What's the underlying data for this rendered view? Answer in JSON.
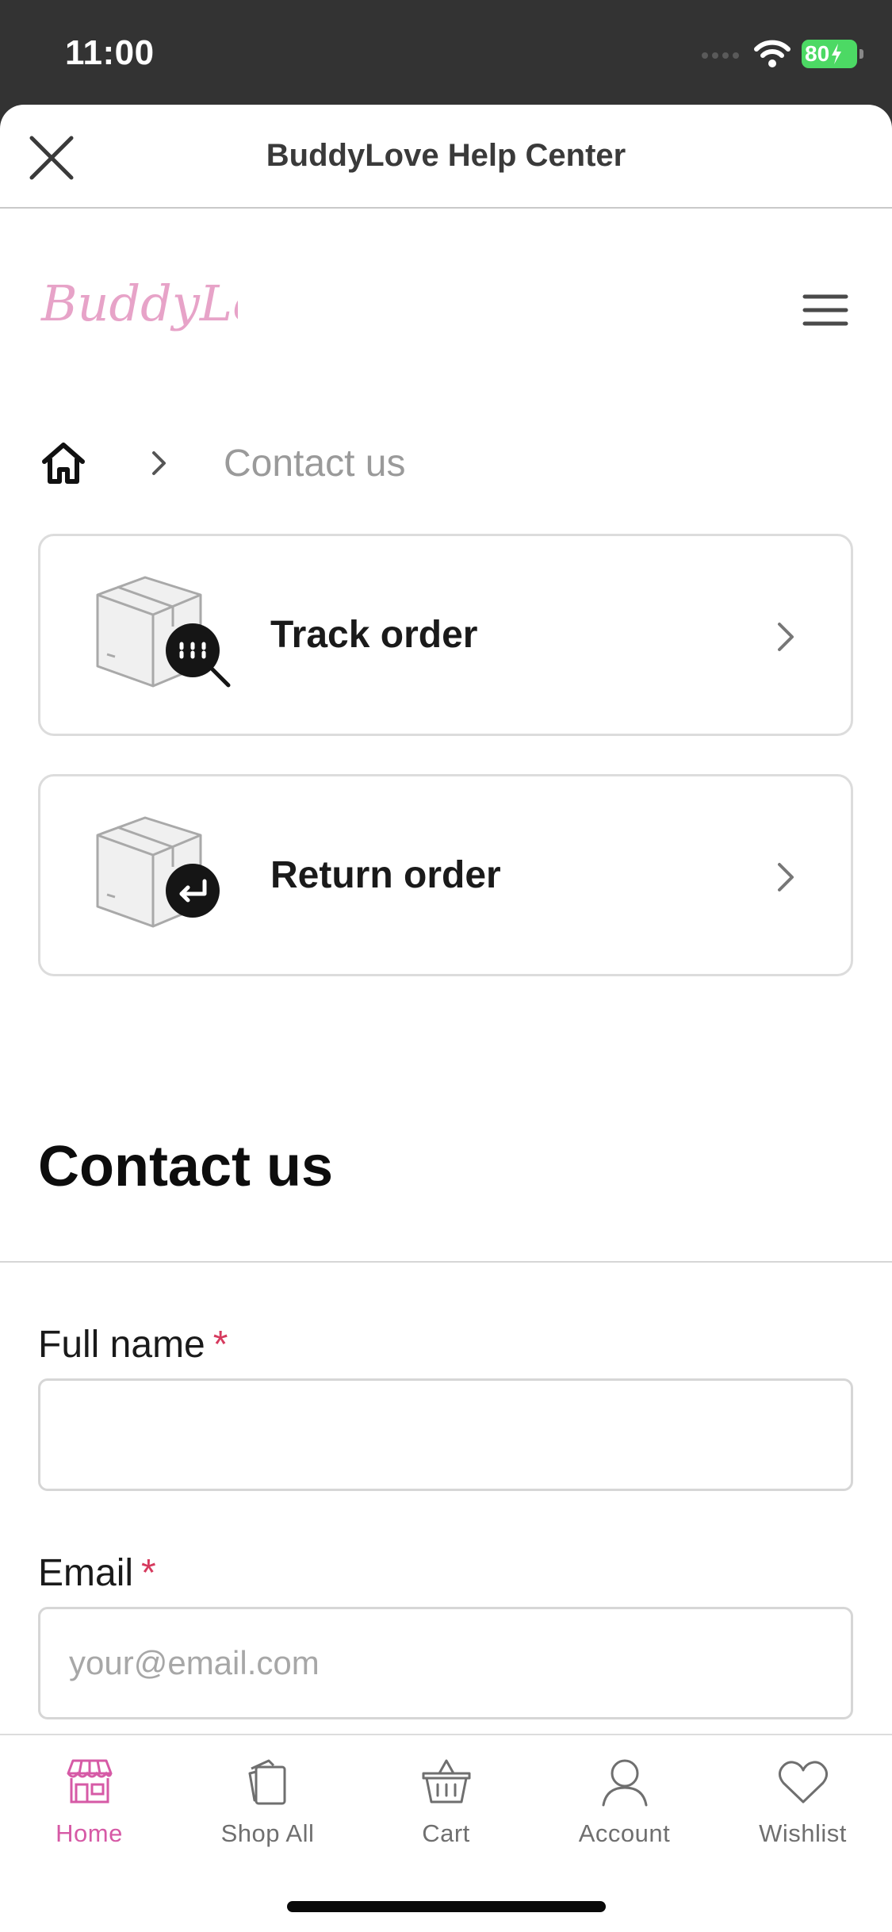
{
  "status_bar": {
    "time": "11:00",
    "battery": "80"
  },
  "header": {
    "title": "BuddyLove Help Center"
  },
  "brand": {
    "logo_text": "BuddyLove"
  },
  "breadcrumb": {
    "current": "Contact us"
  },
  "cards": [
    {
      "label": "Track order"
    },
    {
      "label": "Return order"
    }
  ],
  "contact": {
    "title": "Contact us",
    "fields": [
      {
        "label": "Full name",
        "required_mark": "*",
        "placeholder": ""
      },
      {
        "label": "Email",
        "required_mark": "*",
        "placeholder": "your@email.com"
      }
    ]
  },
  "tabbar": {
    "items": [
      {
        "label": "Home",
        "icon": "store-icon",
        "active": true
      },
      {
        "label": "Shop All",
        "icon": "cards-icon",
        "active": false
      },
      {
        "label": "Cart",
        "icon": "basket-icon",
        "active": false
      },
      {
        "label": "Account",
        "icon": "person-icon",
        "active": false
      },
      {
        "label": "Wishlist",
        "icon": "heart-icon",
        "active": false
      }
    ]
  },
  "colors": {
    "accent": "#d65aa6",
    "required": "#d63a5e",
    "status_bar": "#333333"
  }
}
